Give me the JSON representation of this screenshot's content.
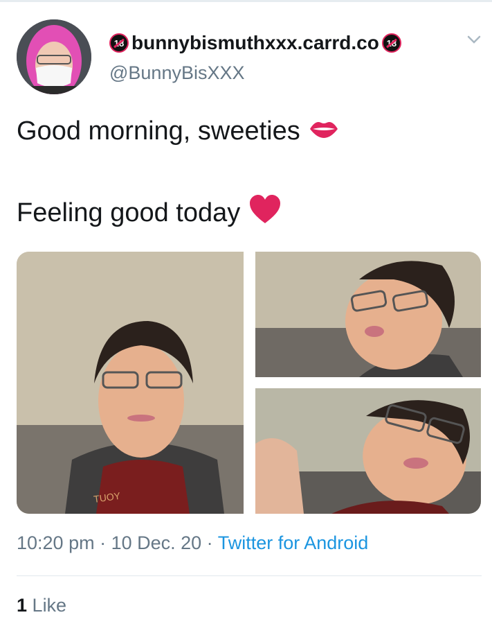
{
  "tweet": {
    "display_name": "bunnybismuthxxx.carrd.co",
    "age_badge": "18",
    "handle": "@BunnyBisXXX",
    "line1": "Good morning, sweeties",
    "line2": "Feeling good today",
    "time": "10:20 pm",
    "separator": " · ",
    "date": "10 Dec. 20",
    "source": "Twitter for Android",
    "like_count": "1",
    "like_label": "Like",
    "shirt_text": "TUOY"
  },
  "icons": {
    "badge": "18-plus-badge-icon",
    "menu": "chevron-down-icon",
    "lips": "kiss-lips-icon",
    "heart": "red-heart-icon"
  },
  "colors": {
    "text": "#14171a",
    "muted": "#657786",
    "link": "#1b95e0",
    "heart": "#e0245e",
    "hood": "#e24fb5"
  }
}
